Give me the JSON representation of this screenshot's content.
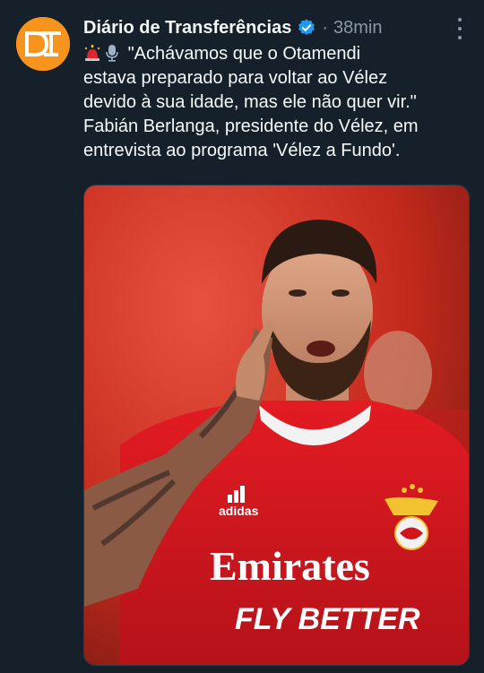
{
  "account": {
    "name": "Diário de Transferências",
    "separator": "·",
    "time": "38min",
    "avatar_colors": {
      "bg": "#f7941d",
      "fg": "#ffffff"
    }
  },
  "tweet": {
    "emojis": [
      "rotating-light-icon",
      "microphone-icon"
    ],
    "lines": [
      "\"Achávamos que o Otamendi",
      "estava preparado para voltar ao Vélez",
      "devido à sua idade, mas ele não quer vir.\"",
      "Fabián Berlanga, presidente do Vélez, em",
      "entrevista ao programa 'Vélez a Fundo'."
    ]
  },
  "media": {
    "shirt_brand": "adidas",
    "sponsor_line1": "Emirates",
    "sponsor_line2": "FLY BETTER",
    "colors": {
      "shirt": "#d2151c",
      "background": "#c9301f",
      "sponsor_text": "#ffffff"
    }
  },
  "colors": {
    "background": "#15202b",
    "text": "#f7f9f9",
    "muted": "#8b98a5",
    "verified": "#1d9bf0"
  }
}
